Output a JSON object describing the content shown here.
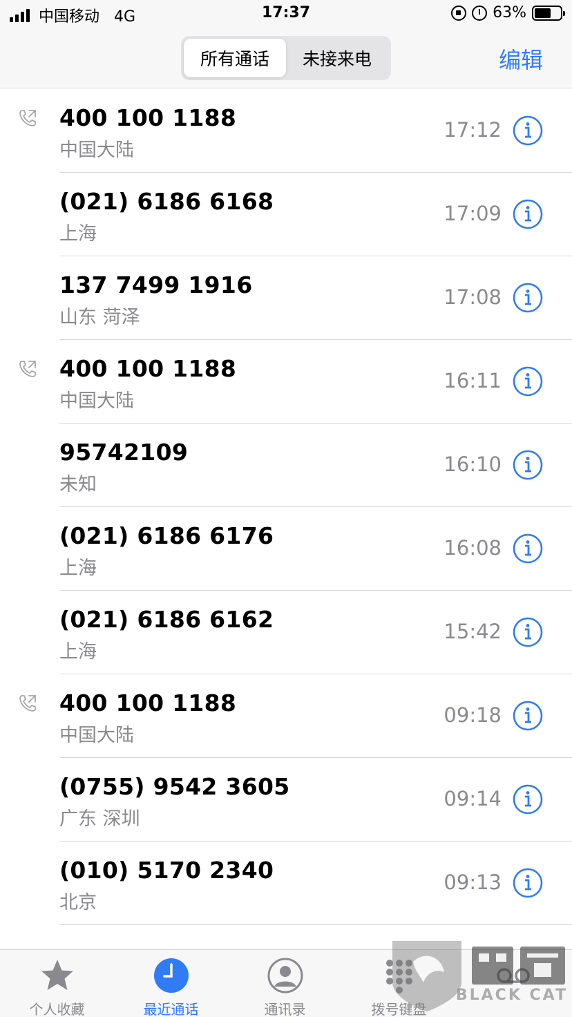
{
  "status_bar": {
    "carrier": "中国移动",
    "network": "4G",
    "time": "17:37",
    "battery_percent": "63%",
    "battery_level": 0.63
  },
  "segmented_control": {
    "all_calls": "所有通话",
    "missed_calls": "未接来电",
    "selected": "all_calls"
  },
  "nav": {
    "edit_label": "编辑"
  },
  "calls": [
    {
      "number": "400 100 1188",
      "location": "中国大陆",
      "time": "17:12",
      "outgoing": true
    },
    {
      "number": "(021) 6186 6168",
      "location": "上海",
      "time": "17:09",
      "outgoing": false
    },
    {
      "number": "137 7499 1916",
      "location": "山东 菏泽",
      "time": "17:08",
      "outgoing": false
    },
    {
      "number": "400 100 1188",
      "location": "中国大陆",
      "time": "16:11",
      "outgoing": true
    },
    {
      "number": "95742109",
      "location": "未知",
      "time": "16:10",
      "outgoing": false
    },
    {
      "number": "(021) 6186 6176",
      "location": "上海",
      "time": "16:08",
      "outgoing": false
    },
    {
      "number": "(021) 6186 6162",
      "location": "上海",
      "time": "15:42",
      "outgoing": false
    },
    {
      "number": "400 100 1188",
      "location": "中国大陆",
      "time": "09:18",
      "outgoing": true
    },
    {
      "number": "(0755) 9542 3605",
      "location": "广东 深圳",
      "time": "09:14",
      "outgoing": false
    },
    {
      "number": "(010) 5170 2340",
      "location": "北京",
      "time": "09:13",
      "outgoing": false
    }
  ],
  "tab_bar": {
    "favorites": "个人收藏",
    "recents": "最近通话",
    "contacts": "通讯录",
    "keypad": "拨号键盘",
    "active": "recents"
  },
  "watermark": {
    "text": "BLACK CAT"
  },
  "colors": {
    "accent": "#2f7cf6",
    "secondary_text": "#8a8a8e",
    "bar_background": "#f7f7f7"
  }
}
